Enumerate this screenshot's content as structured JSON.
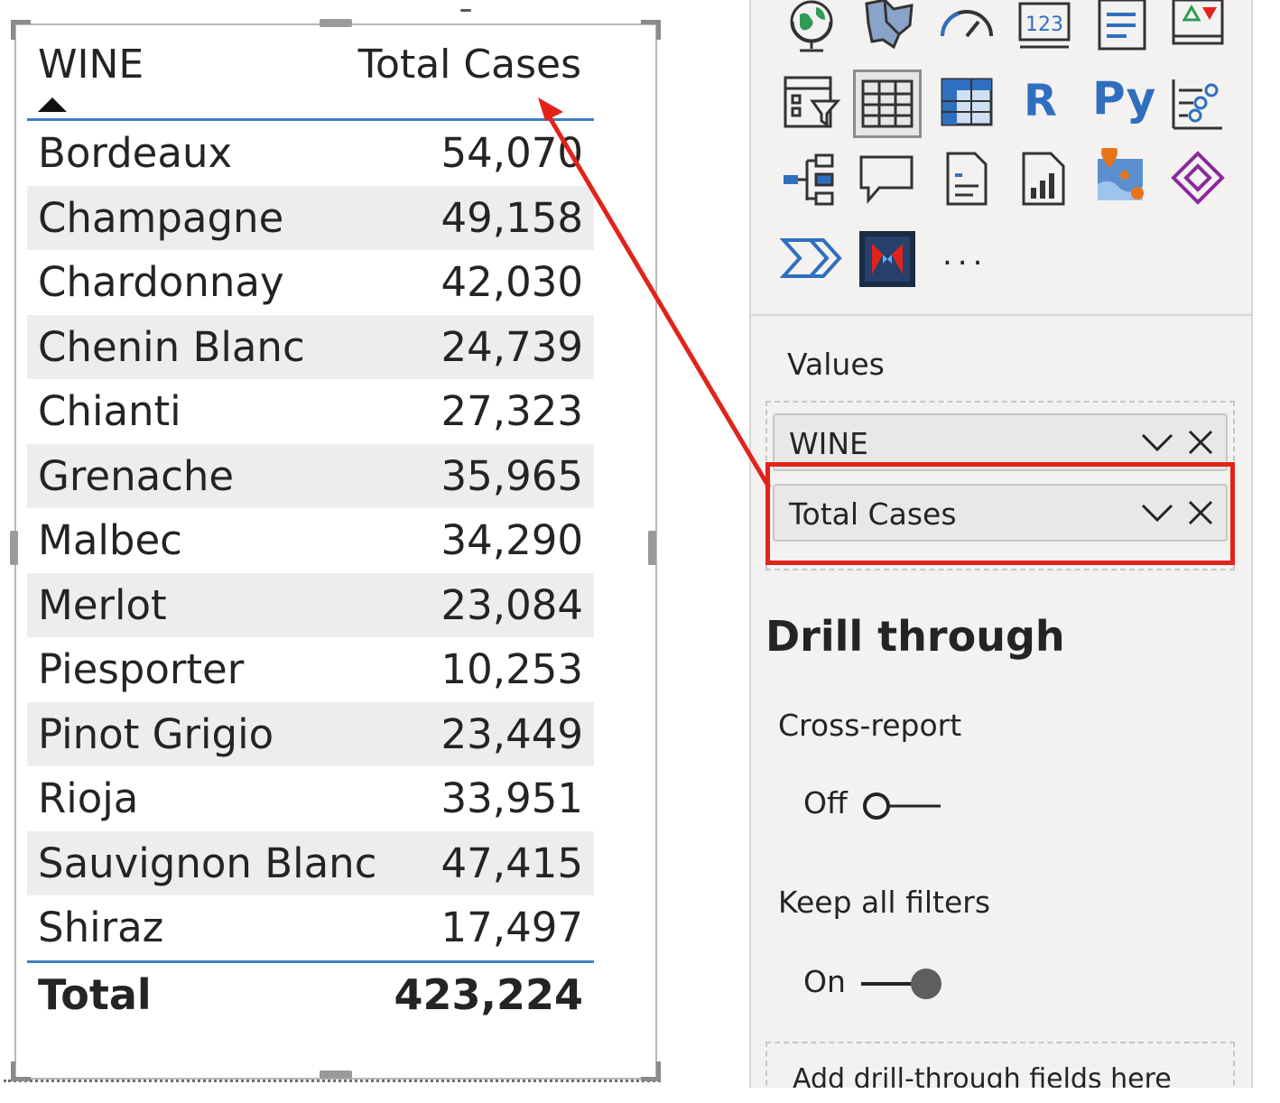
{
  "table": {
    "header_wine": "WINE",
    "header_total": "Total Cases",
    "rows": [
      {
        "wine": "Bordeaux",
        "cases": "54,070"
      },
      {
        "wine": "Champagne",
        "cases": "49,158"
      },
      {
        "wine": "Chardonnay",
        "cases": "42,030"
      },
      {
        "wine": "Chenin Blanc",
        "cases": "24,739"
      },
      {
        "wine": "Chianti",
        "cases": "27,323"
      },
      {
        "wine": "Grenache",
        "cases": "35,965"
      },
      {
        "wine": "Malbec",
        "cases": "34,290"
      },
      {
        "wine": "Merlot",
        "cases": "23,084"
      },
      {
        "wine": "Piesporter",
        "cases": "10,253"
      },
      {
        "wine": "Pinot Grigio",
        "cases": "23,449"
      },
      {
        "wine": "Rioja",
        "cases": "33,951"
      },
      {
        "wine": "Sauvignon Blanc",
        "cases": "47,415"
      },
      {
        "wine": "Shiraz",
        "cases": "17,497"
      }
    ],
    "total_label": "Total",
    "total_value": "423,224",
    "sort": "ascending by WINE"
  },
  "visualizations": {
    "icons": [
      "globe-map-icon",
      "filled-map-icon",
      "gauge-icon",
      "card-icon",
      "multi-row-card-icon",
      "kpi-icon",
      "slicer-icon",
      "table-icon",
      "matrix-icon",
      "r-visual-icon",
      "python-visual-icon",
      "key-influencers-icon",
      "decomposition-tree-icon",
      "qna-icon",
      "smart-narrative-icon",
      "paginated-report-icon",
      "azure-map-icon",
      "power-apps-icon",
      "power-automate-icon",
      "custom-visual-icon",
      "more-visuals-icon"
    ],
    "r_label": "R",
    "py_label": "Py",
    "card_label": "123",
    "more_label": "..."
  },
  "fields": {
    "values_label": "Values",
    "items": [
      {
        "name": "WINE"
      },
      {
        "name": "Total Cases"
      }
    ]
  },
  "drill_through": {
    "title": "Drill through",
    "cross_report_label": "Cross-report",
    "cross_report_state": "Off",
    "keep_filters_label": "Keep all filters",
    "keep_filters_state": "On",
    "add_fields_placeholder": "Add drill-through fields here"
  },
  "colors": {
    "accent_blue": "#3f7fc1",
    "highlight_red": "#e2231a",
    "row_alt": "#ededed",
    "pane_bg": "#f3f2f1"
  }
}
